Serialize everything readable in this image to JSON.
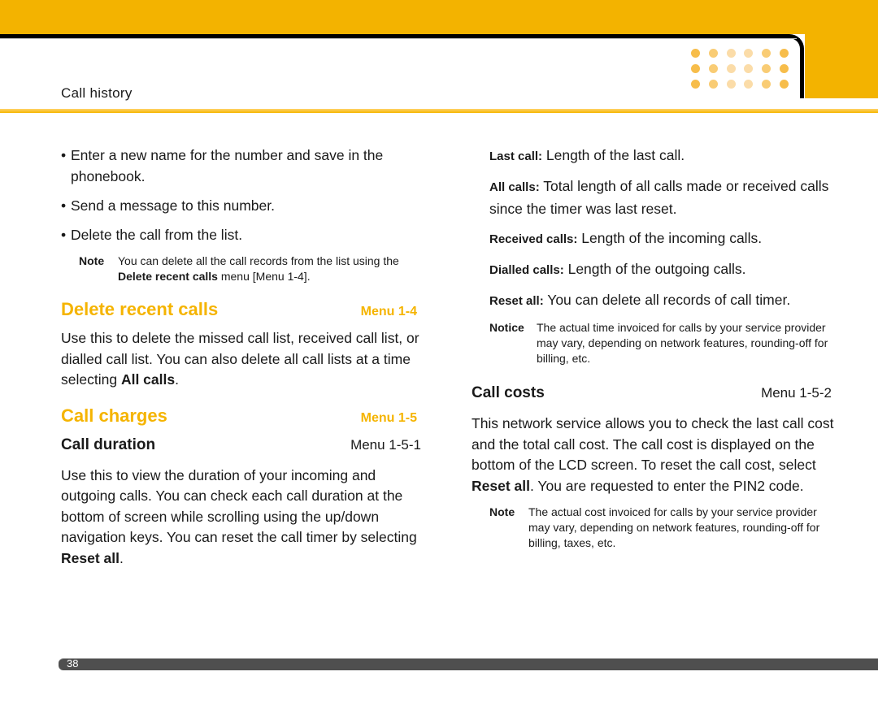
{
  "header": {
    "section_title": "Call history",
    "colors": {
      "band": "#f3b300",
      "accent": "#f5b400",
      "footer": "#4f4f4f"
    },
    "dot_grid": {
      "rows": 3,
      "columns": 6,
      "column_colors": [
        "#f7bd4a",
        "#f9cc74",
        "#fbdca8",
        "#fbdca8",
        "#f9cc74",
        "#f7bd4a"
      ]
    }
  },
  "left": {
    "bullets": [
      "Enter a new name for the number and save in the phonebook.",
      "Send a message to this number.",
      "Delete the call from the list."
    ],
    "note1": {
      "label": "Note",
      "text_pre": "You can delete all the call records from the list using the ",
      "bold": "Delete recent calls",
      "text_post": " menu [Menu 1-4]."
    },
    "delete_recent": {
      "title": "Delete recent calls",
      "menu": "Menu 1-4",
      "text_pre": "Use this to delete the missed call list, received call list, or dialled call list. You can also delete all call lists at a time selecting ",
      "bold": "All calls",
      "text_post": "."
    },
    "call_charges": {
      "title": "Call charges",
      "menu": "Menu 1-5"
    },
    "call_duration": {
      "title": "Call duration",
      "menu": "Menu 1-5-1",
      "text_pre": "Use this to view the duration of your incoming and outgoing calls. You can check each call duration at the bottom of screen while scrolling using the up/down navigation keys. You can reset the call timer by selecting ",
      "bold": "Reset all",
      "text_post": "."
    }
  },
  "right": {
    "definitions": [
      {
        "term": "Last call:",
        "desc": " Length of the last call."
      },
      {
        "term": "All calls:",
        "desc": " Total length of all calls made or received calls since the timer was last reset."
      },
      {
        "term": "Received calls:",
        "desc": " Length of the incoming calls."
      },
      {
        "term": "Dialled calls:",
        "desc": " Length of the outgoing calls."
      },
      {
        "term": "Reset all:",
        "desc": " You can delete all records of call timer."
      }
    ],
    "notice": {
      "label": "Notice",
      "text": "The actual time invoiced for calls by your service provider may vary, depending on network features, rounding-off for billing, etc."
    },
    "call_costs": {
      "title": "Call costs",
      "menu": "Menu 1-5-2",
      "text_pre": "This network service allows you to check the last call cost and the total call cost. The call cost is displayed on the bottom of the LCD screen. To reset the call cost, select ",
      "bold": "Reset all",
      "text_post": ". You are requested to enter the PIN2 code."
    },
    "note2": {
      "label": "Note",
      "text": "The actual cost invoiced for calls by your service provider may vary, depending on network features, rounding-off for billing, taxes, etc."
    }
  },
  "footer": {
    "page_number": "38"
  }
}
